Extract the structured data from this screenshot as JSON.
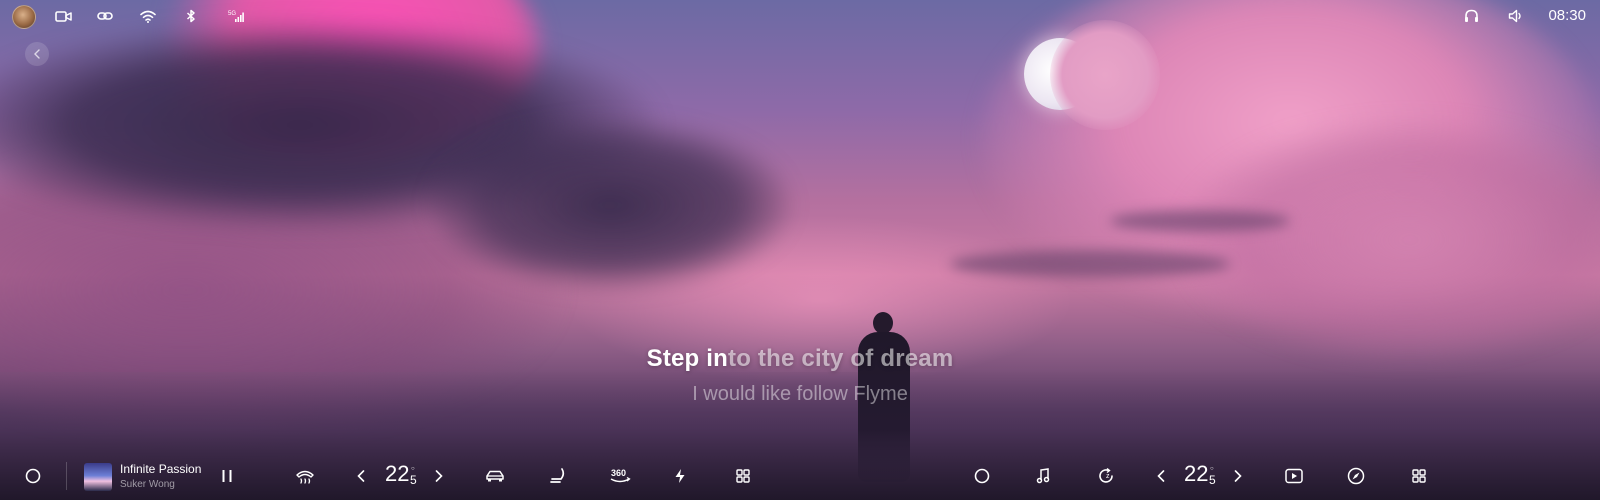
{
  "status_bar": {
    "time": "08:30",
    "network_label": "5G"
  },
  "lyrics": {
    "current_sung": "Step in",
    "current_rest": "to the city of dream",
    "next": "I would like follow Flyme"
  },
  "now_playing": {
    "title": "Infinite Passion",
    "artist": "Suker Wong"
  },
  "climate": {
    "driver_temp_main": "22",
    "driver_temp_decimal": "5",
    "passenger_temp_main": "22",
    "passenger_temp_decimal": "5"
  },
  "dock": {
    "camera_360_label": "360"
  },
  "icons": [
    "avatar",
    "video-camera-icon",
    "link-icon",
    "wifi-icon",
    "bluetooth-icon",
    "cellular-signal-icon",
    "headphones-icon",
    "volume-icon",
    "back-chevron-icon",
    "home-circle-icon",
    "pause-icon",
    "rear-defrost-icon",
    "chevron-left-icon",
    "chevron-right-icon",
    "car-icon",
    "seat-icon",
    "camera-360-icon",
    "charging-bolt-icon",
    "apps-grid-icon",
    "music-note-icon",
    "refresh-icon",
    "play-video-icon",
    "compass-icon"
  ]
}
